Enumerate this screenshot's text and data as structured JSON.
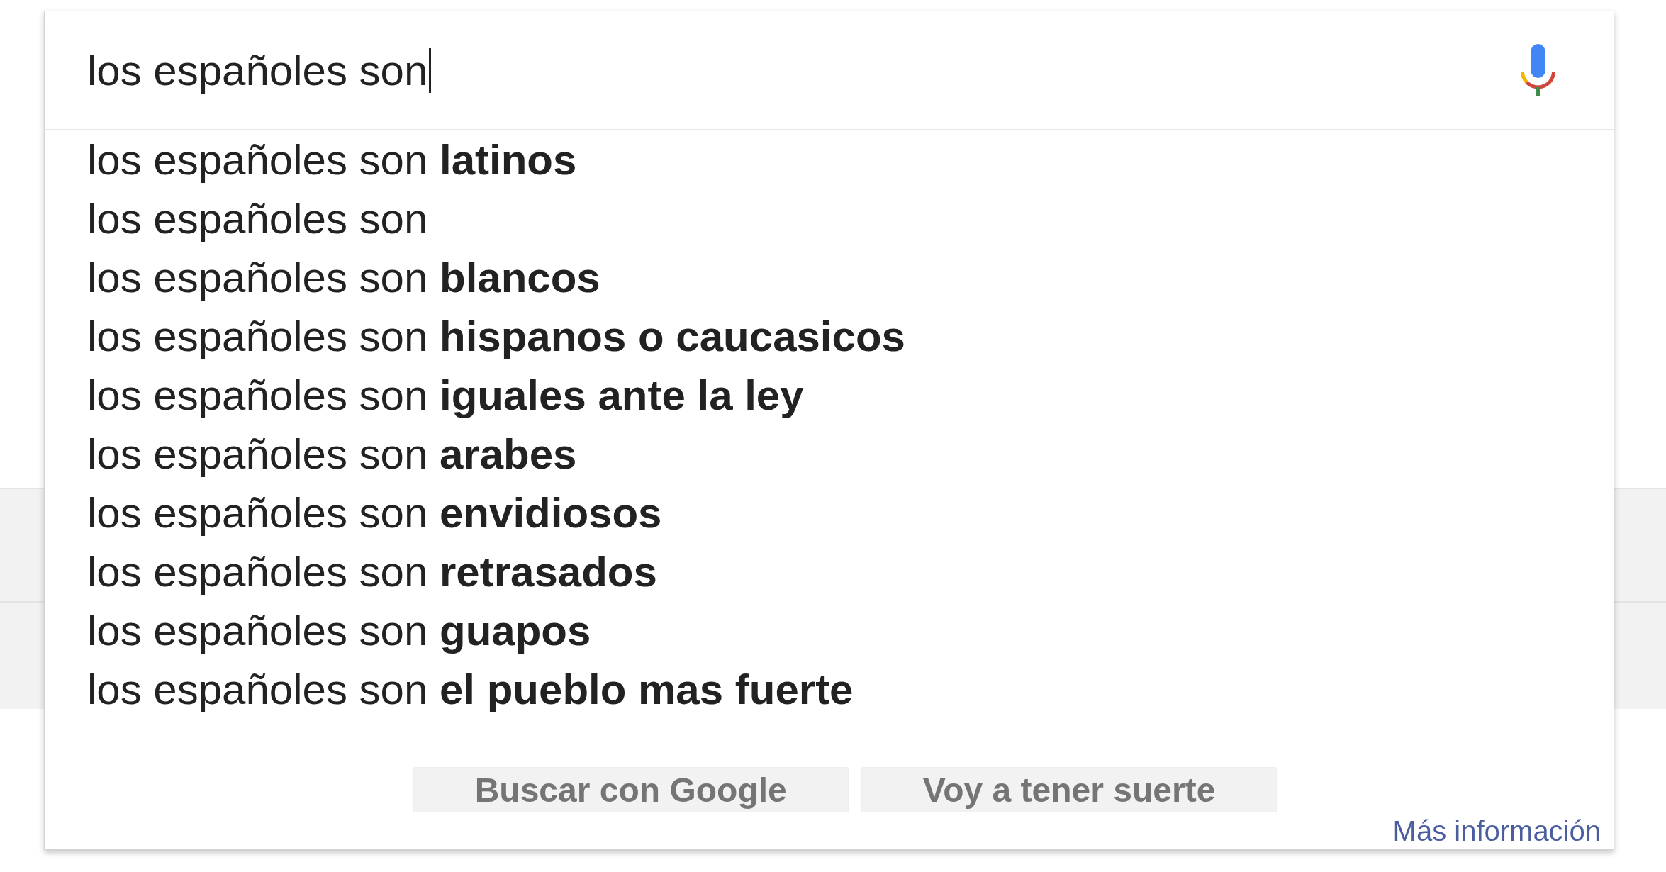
{
  "search": {
    "value": "los españoles son",
    "focused": true
  },
  "suggestions": [
    "los españoles son **latinos**",
    "los españoles son",
    "los españoles son **blancos**",
    "los españoles son **hispanos o caucasicos**",
    "los españoles son **iguales ante la ley**",
    "los españoles son **arabes**",
    "los españoles son **envidiosos**",
    "los españoles son **retrasados**",
    "los españoles son **guapos**",
    "los españoles son **el pueblo mas fuerte**"
  ],
  "buttons": [
    {
      "label": "Buscar con Google"
    },
    {
      "label": "Voy a tener suerte"
    }
  ],
  "link": "Más información"
}
